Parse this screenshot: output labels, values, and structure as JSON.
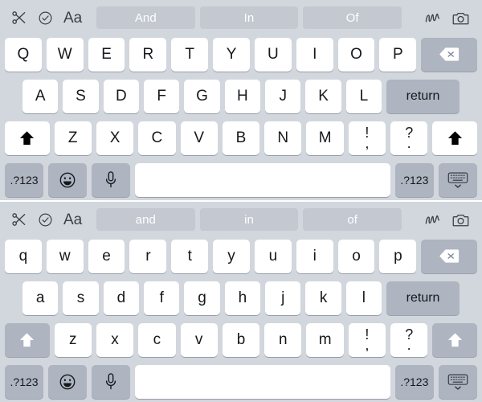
{
  "colors": {
    "keyboard_bg": "#d2d6dd",
    "key_light": "#ffffff",
    "key_dark": "#aeb4c0",
    "suggestion_bg": "#c3c8d1",
    "suggestion_text": "#ffffff",
    "key_text": "#16181c",
    "divider": "#ffffff"
  },
  "keyboards": [
    {
      "id": "uppercase-keyboard",
      "shift_state": "active",
      "toolbar": {
        "left_icons": [
          {
            "name": "scissors-icon",
            "label": "Cut"
          },
          {
            "name": "check-circle-icon",
            "label": "Select"
          },
          {
            "name": "text-format-icon",
            "label": "Aa"
          }
        ],
        "right_icons": [
          {
            "name": "scribble-icon",
            "label": "Handwriting"
          },
          {
            "name": "camera-icon",
            "label": "Camera"
          }
        ],
        "suggestions": [
          "And",
          "In",
          "Of"
        ]
      },
      "rows": [
        [
          "Q",
          "W",
          "E",
          "R",
          "T",
          "Y",
          "U",
          "I",
          "O",
          "P"
        ],
        [
          "A",
          "S",
          "D",
          "F",
          "G",
          "H",
          "J",
          "K",
          "L"
        ],
        [
          "Z",
          "X",
          "C",
          "V",
          "B",
          "N",
          "M"
        ]
      ],
      "backspace_label": "delete-icon",
      "return_label": "return",
      "shift_label": "shift-icon",
      "punct_keys": [
        {
          "top": "!",
          "bottom": ","
        },
        {
          "top": "?",
          "bottom": "."
        }
      ],
      "bottom_row": {
        "numeric_left": ".?123",
        "emoji": "emoji-icon",
        "dictation": "microphone-icon",
        "space": "",
        "numeric_right": ".?123",
        "dismiss": "dismiss-keyboard-icon"
      }
    },
    {
      "id": "lowercase-keyboard",
      "shift_state": "inactive",
      "toolbar": {
        "left_icons": [
          {
            "name": "scissors-icon",
            "label": "Cut"
          },
          {
            "name": "check-circle-icon",
            "label": "Select"
          },
          {
            "name": "text-format-icon",
            "label": "Aa"
          }
        ],
        "right_icons": [
          {
            "name": "scribble-icon",
            "label": "Handwriting"
          },
          {
            "name": "camera-icon",
            "label": "Camera"
          }
        ],
        "suggestions": [
          "and",
          "in",
          "of"
        ]
      },
      "rows": [
        [
          "q",
          "w",
          "e",
          "r",
          "t",
          "y",
          "u",
          "i",
          "o",
          "p"
        ],
        [
          "a",
          "s",
          "d",
          "f",
          "g",
          "h",
          "j",
          "k",
          "l"
        ],
        [
          "z",
          "x",
          "c",
          "v",
          "b",
          "n",
          "m"
        ]
      ],
      "backspace_label": "delete-icon",
      "return_label": "return",
      "shift_label": "shift-icon",
      "punct_keys": [
        {
          "top": "!",
          "bottom": ","
        },
        {
          "top": "?",
          "bottom": "."
        }
      ],
      "bottom_row": {
        "numeric_left": ".?123",
        "emoji": "emoji-icon",
        "dictation": "microphone-icon",
        "space": "",
        "numeric_right": ".?123",
        "dismiss": "dismiss-keyboard-icon"
      }
    }
  ],
  "text_format_glyph": "Aa"
}
